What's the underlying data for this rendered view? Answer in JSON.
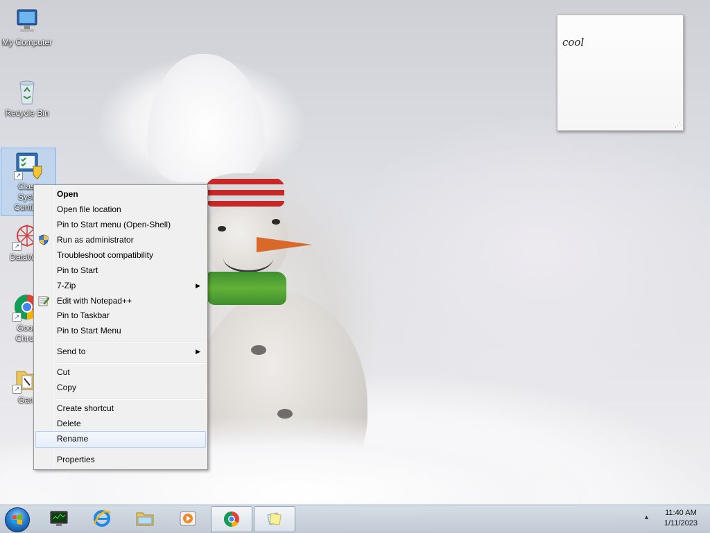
{
  "desktop": {
    "icons": [
      {
        "label": "My Computer"
      },
      {
        "label": "Recycle Bin"
      },
      {
        "label_line1": "Class",
        "label_line2": "Syste",
        "label_line3": "Configu"
      },
      {
        "label": "DataWag"
      },
      {
        "label_line1": "Goog",
        "label_line2": "Chron"
      },
      {
        "label": "Gam"
      }
    ]
  },
  "sticky_note": {
    "text": "cool"
  },
  "context_menu": {
    "items": [
      {
        "label": "Open"
      },
      {
        "label": "Open file location"
      },
      {
        "label": "Pin to Start menu (Open-Shell)"
      },
      {
        "label": "Run as administrator",
        "icon": "uac-shield-icon"
      },
      {
        "label": "Troubleshoot compatibility"
      },
      {
        "label": "Pin to Start"
      },
      {
        "label": "7-Zip",
        "submenu": true
      },
      {
        "label": "Edit with Notepad++",
        "icon": "notepadplusplus-icon"
      },
      {
        "label": "Pin to Taskbar"
      },
      {
        "label": "Pin to Start Menu"
      },
      {
        "label": "Send to",
        "submenu": true
      },
      {
        "label": "Cut"
      },
      {
        "label": "Copy"
      },
      {
        "label": "Create shortcut"
      },
      {
        "label": "Delete"
      },
      {
        "label": "Rename",
        "state": "hover"
      },
      {
        "label": "Properties"
      }
    ],
    "submenu_arrow": "▶"
  },
  "taskbar": {
    "buttons": [
      {
        "icon": "start-orb-icon"
      },
      {
        "icon": "system-monitor-icon"
      },
      {
        "icon": "internet-explorer-icon"
      },
      {
        "icon": "file-explorer-icon"
      },
      {
        "icon": "media-player-icon"
      },
      {
        "icon": "chrome-icon",
        "active": true
      },
      {
        "icon": "sticky-notes-icon",
        "active": true
      }
    ],
    "tray": {
      "show_hidden_arrow": "▲",
      "time": "11:40 AM",
      "date": "1/11/2023"
    }
  },
  "colors": {
    "menu_bg": "#f0f0f0",
    "menu_hover": "#e6eef9",
    "hover_border": "#aecff7",
    "taskbar": "#c8d1dc"
  }
}
